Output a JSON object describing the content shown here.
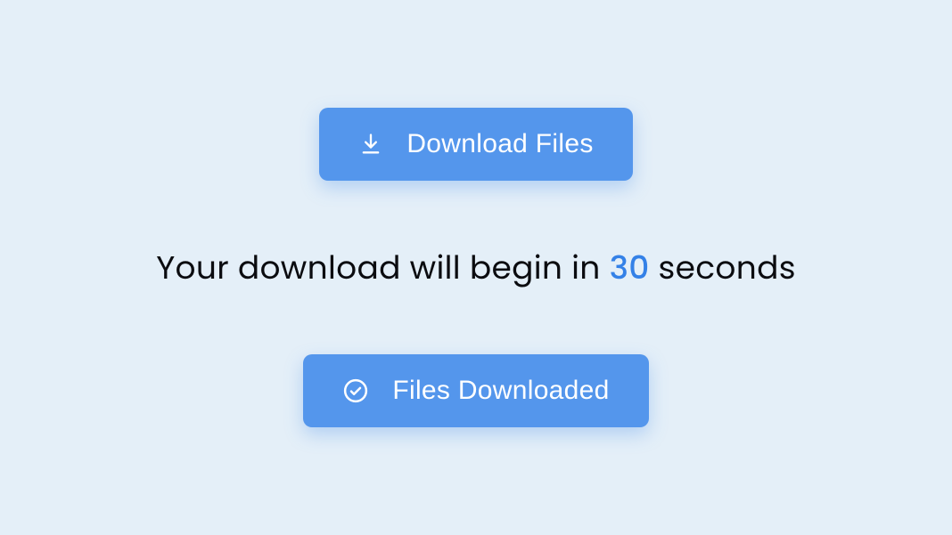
{
  "buttons": {
    "download": {
      "label": "Download Files"
    },
    "downloaded": {
      "label": "Files Downloaded"
    }
  },
  "status": {
    "prefix_text": "Your download will begin in ",
    "seconds": "30",
    "suffix_text": " seconds"
  },
  "colors": {
    "accent": "#5496ec",
    "background": "#e4eff8",
    "text": "#0b0c10",
    "seconds_highlight": "#3481e7"
  }
}
